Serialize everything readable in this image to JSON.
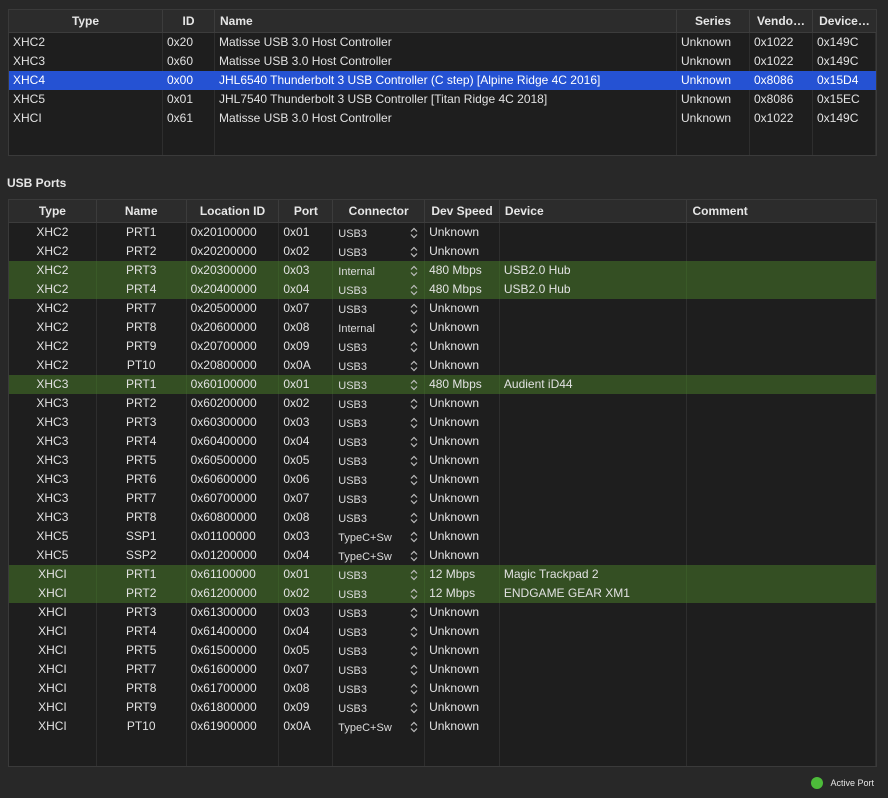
{
  "controllers": {
    "columns": [
      "Type",
      "ID",
      "Name",
      "Series",
      "Vendo…",
      "Device…"
    ],
    "rows": [
      {
        "type": "XHC2",
        "id": "0x20",
        "name": "Matisse USB 3.0 Host Controller",
        "series": "Unknown",
        "vendor": "0x1022",
        "device": "0x149C",
        "selected": false
      },
      {
        "type": "XHC3",
        "id": "0x60",
        "name": "Matisse USB 3.0 Host Controller",
        "series": "Unknown",
        "vendor": "0x1022",
        "device": "0x149C",
        "selected": false
      },
      {
        "type": "XHC4",
        "id": "0x00",
        "name": "JHL6540 Thunderbolt 3 USB Controller (C step) [Alpine Ridge 4C 2016]",
        "series": "Unknown",
        "vendor": "0x8086",
        "device": "0x15D4",
        "selected": true
      },
      {
        "type": "XHC5",
        "id": "0x01",
        "name": "JHL7540 Thunderbolt 3 USB Controller [Titan Ridge 4C 2018]",
        "series": "Unknown",
        "vendor": "0x8086",
        "device": "0x15EC",
        "selected": false
      },
      {
        "type": "XHCI",
        "id": "0x61",
        "name": "Matisse USB 3.0 Host Controller",
        "series": "Unknown",
        "vendor": "0x1022",
        "device": "0x149C",
        "selected": false
      }
    ]
  },
  "ports": {
    "title": "USB Ports",
    "columns": [
      "Type",
      "Name",
      "Location ID",
      "Port",
      "Connector",
      "Dev Speed",
      "Device",
      "Comment"
    ],
    "rows": [
      {
        "type": "XHC2",
        "name": "PRT1",
        "location": "0x20100000",
        "port": "0x01",
        "connector": "USB3",
        "speed": "Unknown",
        "device": "",
        "comment": "",
        "active": false
      },
      {
        "type": "XHC2",
        "name": "PRT2",
        "location": "0x20200000",
        "port": "0x02",
        "connector": "USB3",
        "speed": "Unknown",
        "device": "",
        "comment": "",
        "active": false
      },
      {
        "type": "XHC2",
        "name": "PRT3",
        "location": "0x20300000",
        "port": "0x03",
        "connector": "Internal",
        "speed": "480 Mbps",
        "device": "USB2.0 Hub",
        "comment": "",
        "active": true
      },
      {
        "type": "XHC2",
        "name": "PRT4",
        "location": "0x20400000",
        "port": "0x04",
        "connector": "USB3",
        "speed": "480 Mbps",
        "device": "USB2.0 Hub",
        "comment": "",
        "active": true
      },
      {
        "type": "XHC2",
        "name": "PRT7",
        "location": "0x20500000",
        "port": "0x07",
        "connector": "USB3",
        "speed": "Unknown",
        "device": "",
        "comment": "",
        "active": false
      },
      {
        "type": "XHC2",
        "name": "PRT8",
        "location": "0x20600000",
        "port": "0x08",
        "connector": "Internal",
        "speed": "Unknown",
        "device": "",
        "comment": "",
        "active": false
      },
      {
        "type": "XHC2",
        "name": "PRT9",
        "location": "0x20700000",
        "port": "0x09",
        "connector": "USB3",
        "speed": "Unknown",
        "device": "",
        "comment": "",
        "active": false
      },
      {
        "type": "XHC2",
        "name": "PT10",
        "location": "0x20800000",
        "port": "0x0A",
        "connector": "USB3",
        "speed": "Unknown",
        "device": "",
        "comment": "",
        "active": false
      },
      {
        "type": "XHC3",
        "name": "PRT1",
        "location": "0x60100000",
        "port": "0x01",
        "connector": "USB3",
        "speed": "480 Mbps",
        "device": "Audient iD44",
        "comment": "",
        "active": true
      },
      {
        "type": "XHC3",
        "name": "PRT2",
        "location": "0x60200000",
        "port": "0x02",
        "connector": "USB3",
        "speed": "Unknown",
        "device": "",
        "comment": "",
        "active": false
      },
      {
        "type": "XHC3",
        "name": "PRT3",
        "location": "0x60300000",
        "port": "0x03",
        "connector": "USB3",
        "speed": "Unknown",
        "device": "",
        "comment": "",
        "active": false
      },
      {
        "type": "XHC3",
        "name": "PRT4",
        "location": "0x60400000",
        "port": "0x04",
        "connector": "USB3",
        "speed": "Unknown",
        "device": "",
        "comment": "",
        "active": false
      },
      {
        "type": "XHC3",
        "name": "PRT5",
        "location": "0x60500000",
        "port": "0x05",
        "connector": "USB3",
        "speed": "Unknown",
        "device": "",
        "comment": "",
        "active": false
      },
      {
        "type": "XHC3",
        "name": "PRT6",
        "location": "0x60600000",
        "port": "0x06",
        "connector": "USB3",
        "speed": "Unknown",
        "device": "",
        "comment": "",
        "active": false
      },
      {
        "type": "XHC3",
        "name": "PRT7",
        "location": "0x60700000",
        "port": "0x07",
        "connector": "USB3",
        "speed": "Unknown",
        "device": "",
        "comment": "",
        "active": false
      },
      {
        "type": "XHC3",
        "name": "PRT8",
        "location": "0x60800000",
        "port": "0x08",
        "connector": "USB3",
        "speed": "Unknown",
        "device": "",
        "comment": "",
        "active": false
      },
      {
        "type": "XHC5",
        "name": "SSP1",
        "location": "0x01100000",
        "port": "0x03",
        "connector": "TypeC+Sw",
        "speed": "Unknown",
        "device": "",
        "comment": "",
        "active": false
      },
      {
        "type": "XHC5",
        "name": "SSP2",
        "location": "0x01200000",
        "port": "0x04",
        "connector": "TypeC+Sw",
        "speed": "Unknown",
        "device": "",
        "comment": "",
        "active": false
      },
      {
        "type": "XHCI",
        "name": "PRT1",
        "location": "0x61100000",
        "port": "0x01",
        "connector": "USB3",
        "speed": "12 Mbps",
        "device": "Magic Trackpad 2",
        "comment": "",
        "active": true
      },
      {
        "type": "XHCI",
        "name": "PRT2",
        "location": "0x61200000",
        "port": "0x02",
        "connector": "USB3",
        "speed": "12 Mbps",
        "device": "ENDGAME GEAR XM1",
        "comment": "",
        "active": true
      },
      {
        "type": "XHCI",
        "name": "PRT3",
        "location": "0x61300000",
        "port": "0x03",
        "connector": "USB3",
        "speed": "Unknown",
        "device": "",
        "comment": "",
        "active": false
      },
      {
        "type": "XHCI",
        "name": "PRT4",
        "location": "0x61400000",
        "port": "0x04",
        "connector": "USB3",
        "speed": "Unknown",
        "device": "",
        "comment": "",
        "active": false
      },
      {
        "type": "XHCI",
        "name": "PRT5",
        "location": "0x61500000",
        "port": "0x05",
        "connector": "USB3",
        "speed": "Unknown",
        "device": "",
        "comment": "",
        "active": false
      },
      {
        "type": "XHCI",
        "name": "PRT7",
        "location": "0x61600000",
        "port": "0x07",
        "connector": "USB3",
        "speed": "Unknown",
        "device": "",
        "comment": "",
        "active": false
      },
      {
        "type": "XHCI",
        "name": "PRT8",
        "location": "0x61700000",
        "port": "0x08",
        "connector": "USB3",
        "speed": "Unknown",
        "device": "",
        "comment": "",
        "active": false
      },
      {
        "type": "XHCI",
        "name": "PRT9",
        "location": "0x61800000",
        "port": "0x09",
        "connector": "USB3",
        "speed": "Unknown",
        "device": "",
        "comment": "",
        "active": false
      },
      {
        "type": "XHCI",
        "name": "PT10",
        "location": "0x61900000",
        "port": "0x0A",
        "connector": "TypeC+Sw",
        "speed": "Unknown",
        "device": "",
        "comment": "",
        "active": false
      }
    ]
  },
  "legend": {
    "label": "Active Port",
    "color": "#4dbb3a"
  },
  "colors": {
    "selected_row": "#2552d3",
    "active_row": "#344f23",
    "background": "#282828"
  },
  "icons": {
    "connector_popup": "updown-chevron-icon"
  }
}
